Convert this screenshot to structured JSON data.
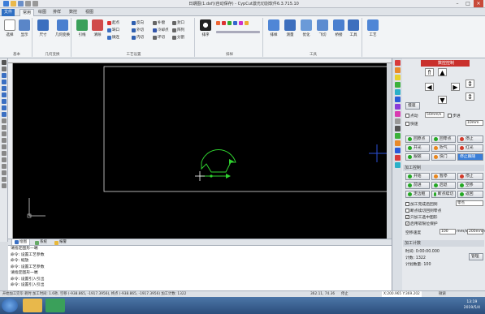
{
  "window": {
    "title": "日期图(1.dxf)(自动保存) - CypCut激光切割软件6.3.715.10"
  },
  "colors": {
    "accent": "#2f6fc2",
    "canvas_bg": "#000000",
    "path_green": "#2fd12f",
    "dot_green": "#23a823",
    "dot_orange": "#e8861c",
    "dot_red": "#d23a2a"
  },
  "tabs": [
    "文件",
    "常用",
    "绘图",
    "排样",
    "数控",
    "视图"
  ],
  "ribbon": {
    "groups": [
      {
        "label": "基本"
      },
      {
        "label": "几何变换"
      },
      {
        "label": "工艺设置"
      },
      {
        "label": "排样"
      },
      {
        "label": "工具"
      }
    ],
    "buttons": {
      "select": "选择",
      "display": "显示",
      "size": "尺寸",
      "transform": "几何变换",
      "lead": "引线",
      "clear": "清除",
      "sort": "排序",
      "layer": "图层",
      "measure": "测量",
      "optimize": "优化",
      "nest": "排样",
      "tools": "工具",
      "flycut": "飞切",
      "bridge": "桥接",
      "process": "工艺"
    },
    "small": {
      "start_point": "起点",
      "gap": "缺口",
      "microjoint": "微连",
      "reverse": "反向",
      "outer": "外切",
      "inner": "内切",
      "compensate": "补偿",
      "cooling": "冷却点",
      "ring": "环切",
      "inner_outer": "内外",
      "seal": "封口",
      "array": "阵列",
      "split": "分割",
      "lead_sort": "引线排序",
      "nest_sort": "排序"
    }
  },
  "right_panel": {
    "title": "数控控制",
    "jog_label": "慢速",
    "checkbox1": "点动",
    "speed_value": "50mm/s",
    "step": "步进",
    "step_value": "10mm",
    "fast": "快速",
    "buttons": {
      "return_origin": "回原点",
      "return_zero": "回零点",
      "stop": "停止",
      "light": "开光",
      "gas": "吹气",
      "red": "红光",
      "follow": "跟随",
      "shutter": "快门",
      "stop_follow": "停止跟随"
    },
    "proc_header": "加工控制",
    "proc_buttons": {
      "start": "开始",
      "pause": "暂停",
      "stop2": "停止",
      "forward": "前进",
      "backward": "后退",
      "walk": "走边框",
      "empty_move": "空移",
      "breakpoint": "断点续切",
      "return": "返回"
    },
    "options": [
      "加工完成后回到",
      "断点续切回到零点",
      "只加工选中图形",
      "启用软限位保护"
    ],
    "return_to": "零点",
    "speed_label": "空移速度",
    "speed1": "100",
    "speed1_unit": "mm/s",
    "speed2": "200mm/s",
    "count_header": "加工计数",
    "time_label": "时间",
    "time_value": "0:00:00.000",
    "count_label": "计数",
    "count_value": "1322",
    "plan_label": "计划数量",
    "plan_value": "100",
    "manage": "管理"
  },
  "bottom_tabs": [
    "绘图",
    "系统",
    "报警"
  ],
  "log_lines": [
    "请指定图形一端",
    "命令: 设置工艺参数",
    "命令: 缩放",
    "命令: 设置工艺参数",
    "请指定图形一端",
    "命令: 设置引入引出",
    "命令: 设置引入引出",
    "命令: 清除起点"
  ],
  "status": {
    "left": "开始加工完毕 耗时 加工时间: 1.6秒, 空移 (-938.865, -1917.3956), 终点 (-938.865, -1917.3956) 加工计数: 1322",
    "coords": "362.11, 74.36",
    "state": "停止",
    "pos": "X:200.965 Y:369.202",
    "fine": "微调"
  },
  "taskbar": {
    "time": "13:19",
    "date": "2019/5/4"
  }
}
